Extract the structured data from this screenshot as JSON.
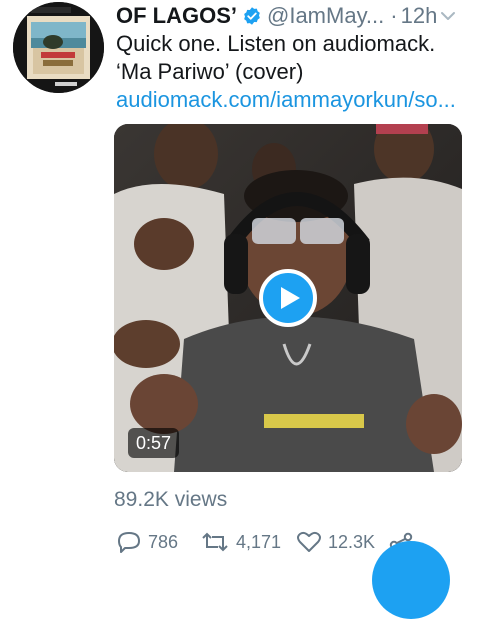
{
  "account": {
    "name": "OF LAGOS’",
    "handle": "@IamMay...",
    "separator": "·",
    "time": "12h"
  },
  "tweet": {
    "line1": "Quick one. Listen on audiomack.",
    "line2": "‘Ma Pariwo’ (cover)",
    "link": "audiomack.com/iammayorkun/so..."
  },
  "media": {
    "duration": "0:57"
  },
  "stats": {
    "views": "89.2K views"
  },
  "actions": {
    "replies": "786",
    "retweets": "4,171",
    "likes": "12.3K"
  },
  "colors": {
    "accent": "#1da1f2",
    "link": "#1b95e0",
    "secondary": "#657786"
  }
}
